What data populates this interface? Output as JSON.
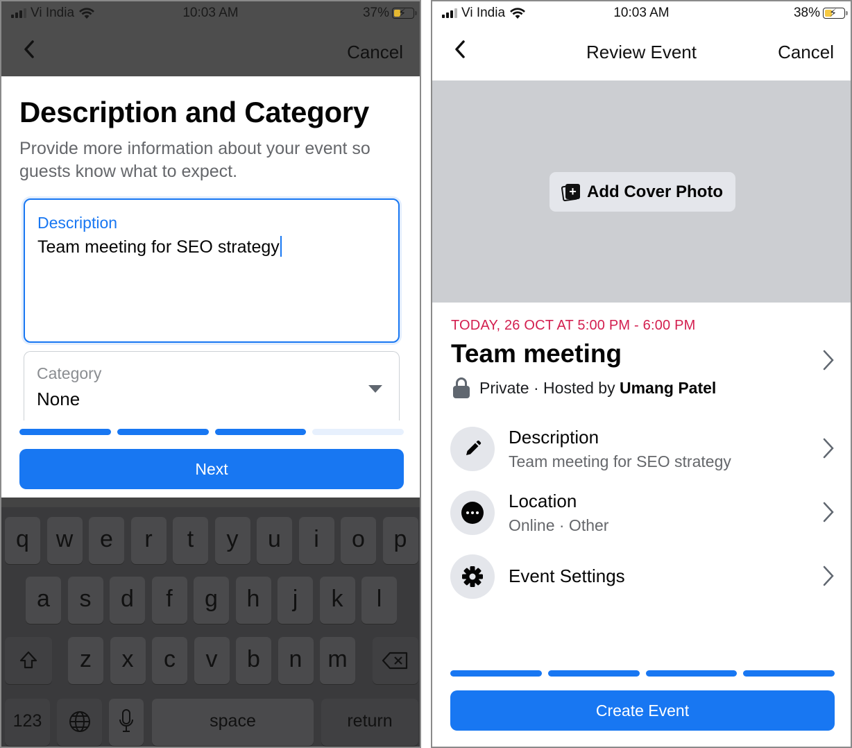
{
  "left_screen": {
    "status_bar": {
      "carrier": "Vi India",
      "time": "10:03 AM",
      "battery": "37%"
    },
    "nav": {
      "cancel_label": "Cancel"
    },
    "heading": "Description and Category",
    "subheading": "Provide more information about your event so guests know what to expect.",
    "description_field": {
      "label": "Description",
      "value": "Team meeting for SEO strategy"
    },
    "category_field": {
      "label": "Category",
      "value": "None"
    },
    "progress": {
      "steps_total": 4,
      "steps_complete": 3
    },
    "next_button": "Next",
    "keyboard": {
      "row1": [
        "q",
        "w",
        "e",
        "r",
        "t",
        "y",
        "u",
        "i",
        "o",
        "p"
      ],
      "row2": [
        "a",
        "s",
        "d",
        "f",
        "g",
        "h",
        "j",
        "k",
        "l"
      ],
      "row3": [
        "z",
        "x",
        "c",
        "v",
        "b",
        "n",
        "m"
      ],
      "numbers_key": "123",
      "space_key": "space",
      "return_key": "return"
    }
  },
  "right_screen": {
    "status_bar": {
      "carrier": "Vi India",
      "time": "10:03 AM",
      "battery": "38%"
    },
    "nav": {
      "title": "Review Event",
      "cancel_label": "Cancel"
    },
    "add_cover_photo": "Add Cover Photo",
    "event": {
      "date_time": "TODAY, 26 OCT AT 5:00 PM - 6:00 PM",
      "title": "Team meeting",
      "privacy": "Private",
      "hosted_by_label": "Hosted by",
      "host": "Umang Patel"
    },
    "details": [
      {
        "icon": "pencil-icon",
        "title": "Description",
        "subtitle": "Team meeting for SEO strategy"
      },
      {
        "icon": "more-dots-icon",
        "title": "Location",
        "subtitle": "Online · Other"
      },
      {
        "icon": "gear-icon",
        "title": "Event Settings",
        "subtitle": ""
      }
    ],
    "progress": {
      "steps_total": 4,
      "steps_complete": 4
    },
    "create_button": "Create Event"
  },
  "colors": {
    "accent": "#1877f2",
    "date": "#d31f4f",
    "secondary_text": "#65676b"
  }
}
